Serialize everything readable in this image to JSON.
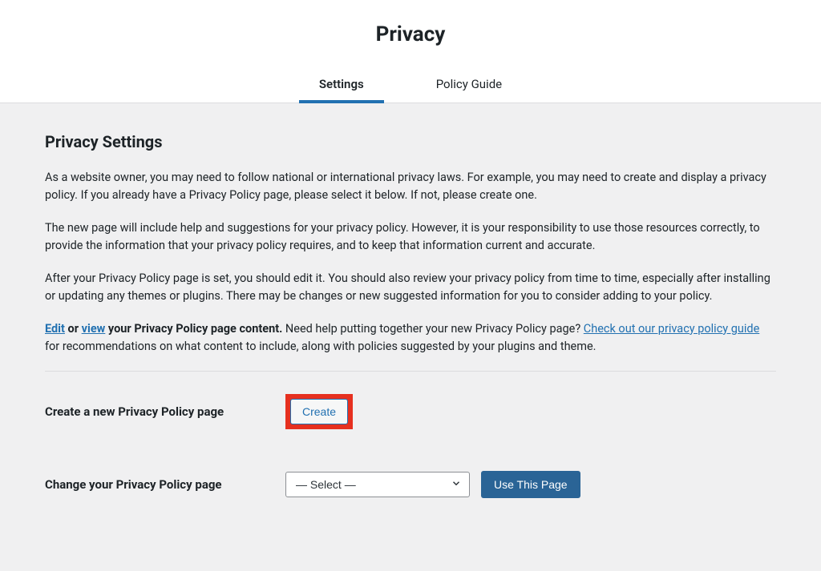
{
  "header": {
    "title": "Privacy",
    "tabs": {
      "settings": "Settings",
      "guide": "Policy Guide"
    }
  },
  "section": {
    "title": "Privacy Settings",
    "p1": "As a website owner, you may need to follow national or international privacy laws. For example, you may need to create and display a privacy policy. If you already have a Privacy Policy page, please select it below. If not, please create one.",
    "p2": "The new page will include help and suggestions for your privacy policy. However, it is your responsibility to use those resources correctly, to provide the information that your privacy policy requires, and to keep that information current and accurate.",
    "p3": "After your Privacy Policy page is set, you should edit it. You should also review your privacy policy from time to time, especially after installing or updating any themes or plugins. There may be changes or new suggested information for you to consider adding to your policy.",
    "p4": {
      "edit": "Edit",
      "or": " or ",
      "view": "view",
      "rest1": " your Privacy Policy page content.",
      "rest2": " Need help putting together your new Privacy Policy page? ",
      "link": "Check out our privacy policy guide",
      "rest3": " for recommendations on what content to include, along with policies suggested by your plugins and theme."
    }
  },
  "form": {
    "create_label": "Create a new Privacy Policy page",
    "create_button": "Create",
    "change_label": "Change your Privacy Policy page",
    "select_value": "— Select —",
    "use_button": "Use This Page"
  }
}
